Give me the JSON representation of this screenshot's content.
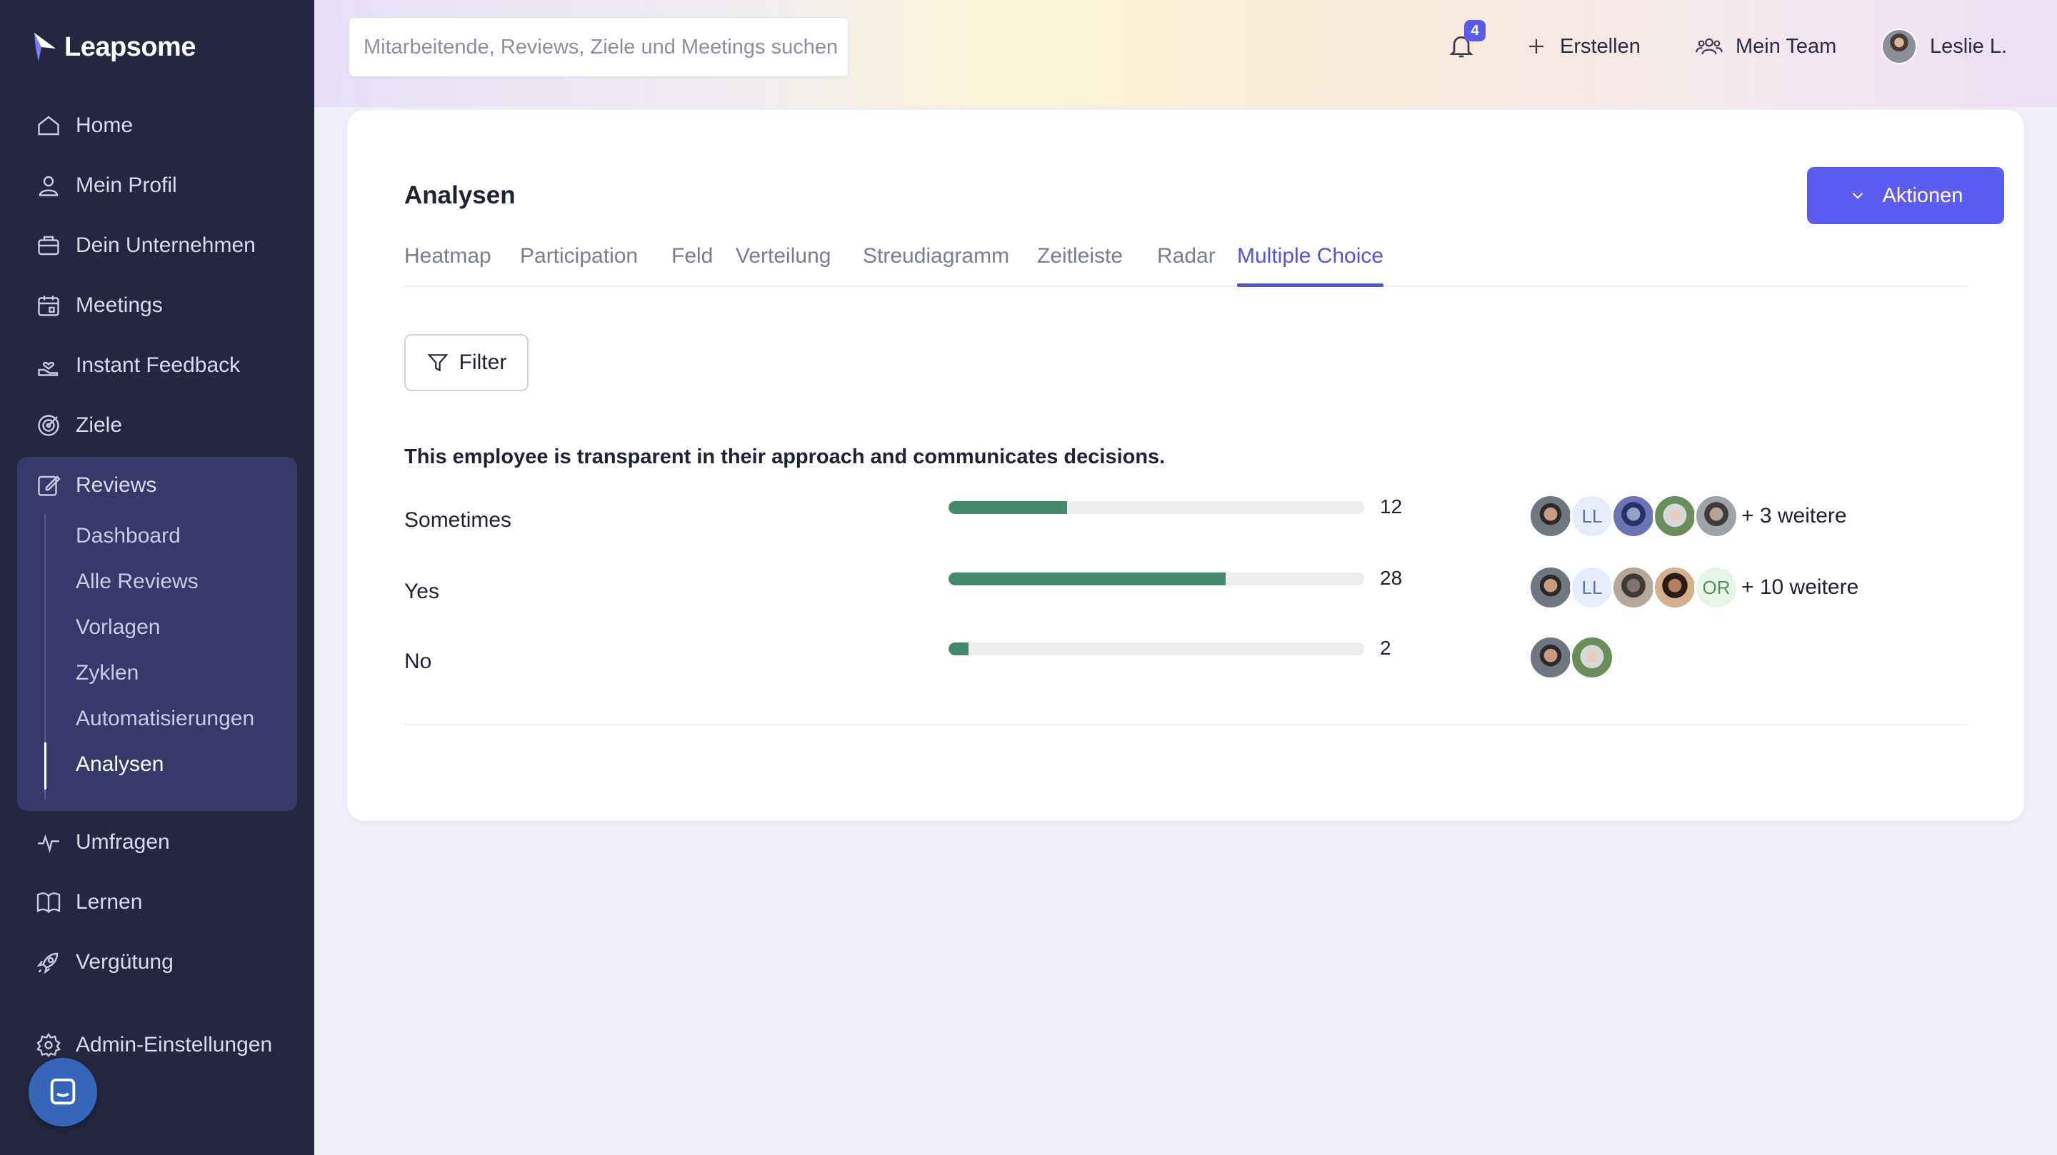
{
  "app": {
    "brand": "Leapsome"
  },
  "sidebar": {
    "items": [
      {
        "label": "Home",
        "icon": "home-icon"
      },
      {
        "label": "Mein Profil",
        "icon": "user-icon"
      },
      {
        "label": "Dein Unternehmen",
        "icon": "briefcase-icon"
      },
      {
        "label": "Meetings",
        "icon": "calendar-icon"
      },
      {
        "label": "Instant Feedback",
        "icon": "hand-heart-icon"
      },
      {
        "label": "Ziele",
        "icon": "target-icon"
      },
      {
        "label": "Reviews",
        "icon": "edit-icon"
      },
      {
        "label": "Umfragen",
        "icon": "pulse-icon"
      },
      {
        "label": "Lernen",
        "icon": "book-icon"
      },
      {
        "label": "Vergütung",
        "icon": "rocket-icon"
      },
      {
        "label": "Admin-Einstellungen",
        "icon": "gear-icon"
      }
    ],
    "reviews_sub": [
      "Dashboard",
      "Alle Reviews",
      "Vorlagen",
      "Zyklen",
      "Automatisierungen",
      "Analysen"
    ],
    "active_sub": "Analysen"
  },
  "topbar": {
    "search_placeholder": "Mitarbeitende, Reviews, Ziele und Meetings suchen",
    "notification_count": "4",
    "create_label": "Erstellen",
    "team_label": "Mein Team",
    "user_name": "Leslie L."
  },
  "main": {
    "title": "Analysen",
    "actions_label": "Aktionen",
    "tabs": [
      "Heatmap",
      "Participation",
      "Feld",
      "Verteilung",
      "Streudiagramm",
      "Zeitleiste",
      "Radar",
      "Multiple Choice"
    ],
    "active_tab": "Multiple Choice",
    "filter_label": "Filter",
    "question": "This employee is transparent in their approach and communicates decisions.",
    "answers": [
      {
        "label": "Sometimes",
        "count": "12",
        "share": 0.286,
        "more": "+ 3 weitere"
      },
      {
        "label": "Yes",
        "count": "28",
        "share": 0.667,
        "more": "+ 10 weitere"
      },
      {
        "label": "No",
        "count": "2",
        "share": 0.048,
        "more": ""
      }
    ],
    "initials": {
      "ll": "LL",
      "or": "OR"
    }
  },
  "colors": {
    "accent": "#5d5cf0",
    "bar": "#438a6d",
    "sidebar": "#24273f"
  }
}
